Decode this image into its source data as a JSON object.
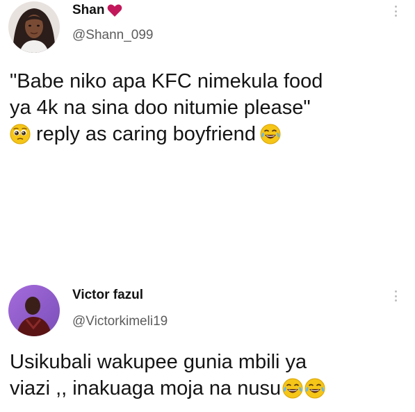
{
  "tweets": [
    {
      "display_name": "Shan",
      "handle": "@Shann_099",
      "text_lines": [
        "\"Babe niko apa KFC nimekula food",
        "ya 4k na sina doo nitumie please\"",
        "reply as caring boyfriend"
      ],
      "icons": {
        "name_badge": "heart-icon",
        "line3_lead": "pleading-face-emoji",
        "line3_trail": "tears-of-joy-emoji"
      }
    },
    {
      "display_name": "Victor fazul",
      "handle": "@Victorkimeli19",
      "text_lines": [
        "Usikubali wakupee gunia mbili ya",
        "viazi ,, inakuaga moja na nusu"
      ],
      "icons": {
        "line2_trail": [
          "tears-of-joy-emoji",
          "tears-of-joy-emoji"
        ]
      }
    }
  ],
  "colors": {
    "background": "#ffffff",
    "text": "#141414",
    "handle": "#5c5c5c",
    "heart": "#c2185b",
    "emoji_face": "#f5c518"
  }
}
